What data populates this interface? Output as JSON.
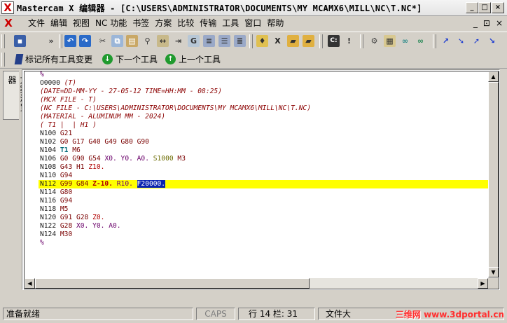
{
  "window": {
    "title": "Mastercam X 编辑器 - [C:\\USERS\\ADMINISTRATOR\\DOCUMENTS\\MY MCAMX6\\MILL\\NC\\T.NC*]",
    "logo_letter": "X",
    "controls": [
      "_",
      "□",
      "×"
    ]
  },
  "menu": {
    "items": [
      "文件",
      "编辑",
      "视图",
      "NC 功能",
      "书签",
      "方案",
      "比较",
      "传输",
      "工具",
      "窗口",
      "帮助"
    ],
    "mdi_controls": [
      "_",
      "⊡",
      "×"
    ]
  },
  "toolbar2": {
    "mark_label": "标记所有工具变更",
    "next_label": "下一个工具",
    "prev_label": "上一个工具"
  },
  "side_tab": {
    "label": "方案浏览器"
  },
  "code": {
    "l0": "%",
    "l1a": "O0000 ",
    "l1b": "(T)",
    "l2": "(DATE=DD-MM-YY - 27-05-12 TIME=HH:MM - 08:25)",
    "l3": "(MCX FILE - T)",
    "l4": "(NC FILE - C:\\USERS\\ADMINISTRATOR\\DOCUMENTS\\MY MCAMX6\\MILL\\NC\\T.NC)",
    "l5": "(MATERIAL - ALUMINUM MM - 2024)",
    "l6": "( T1 |  | H1 )",
    "l7a": "N100 ",
    "l7b": "G21",
    "l8a": "N102 ",
    "l8b": "G0 G17 G40 G49 G80 G90",
    "l9a": "N104 ",
    "l9b": "T1",
    "l9c": " M6",
    "l10a": "N106 ",
    "l10b": "G0 G90 G54 ",
    "l10c": "X0. Y0. A0. ",
    "l10d": "S1000",
    "l10e": " M3",
    "l11a": "N108 ",
    "l11b": "G43 H1 ",
    "l11c": "Z10.",
    "l12a": "N110 ",
    "l12b": "G94",
    "l13a": "N112 ",
    "l13b": "G99 G84 ",
    "l13c": "Z-10.",
    "l13d": " R10. ",
    "l13e": "F20000.",
    "l14a": "N114 ",
    "l14b": "G80",
    "l15a": "N116 ",
    "l15b": "G94",
    "l16a": "N118 ",
    "l16b": "M5",
    "l17a": "N120 ",
    "l17b": "G91 G28 ",
    "l17c": "Z0.",
    "l18a": "N122 ",
    "l18b": "G28 ",
    "l18c": "X0. Y0. A0.",
    "l19a": "N124 ",
    "l19b": "M30",
    "l20": "%"
  },
  "status": {
    "ready": "准备就绪",
    "caps": "CAPS",
    "position": "行 14  栏: 31",
    "file_size": "文件大",
    "watermark_cn": "三维网",
    "watermark_url": "www.3dportal.cn"
  }
}
